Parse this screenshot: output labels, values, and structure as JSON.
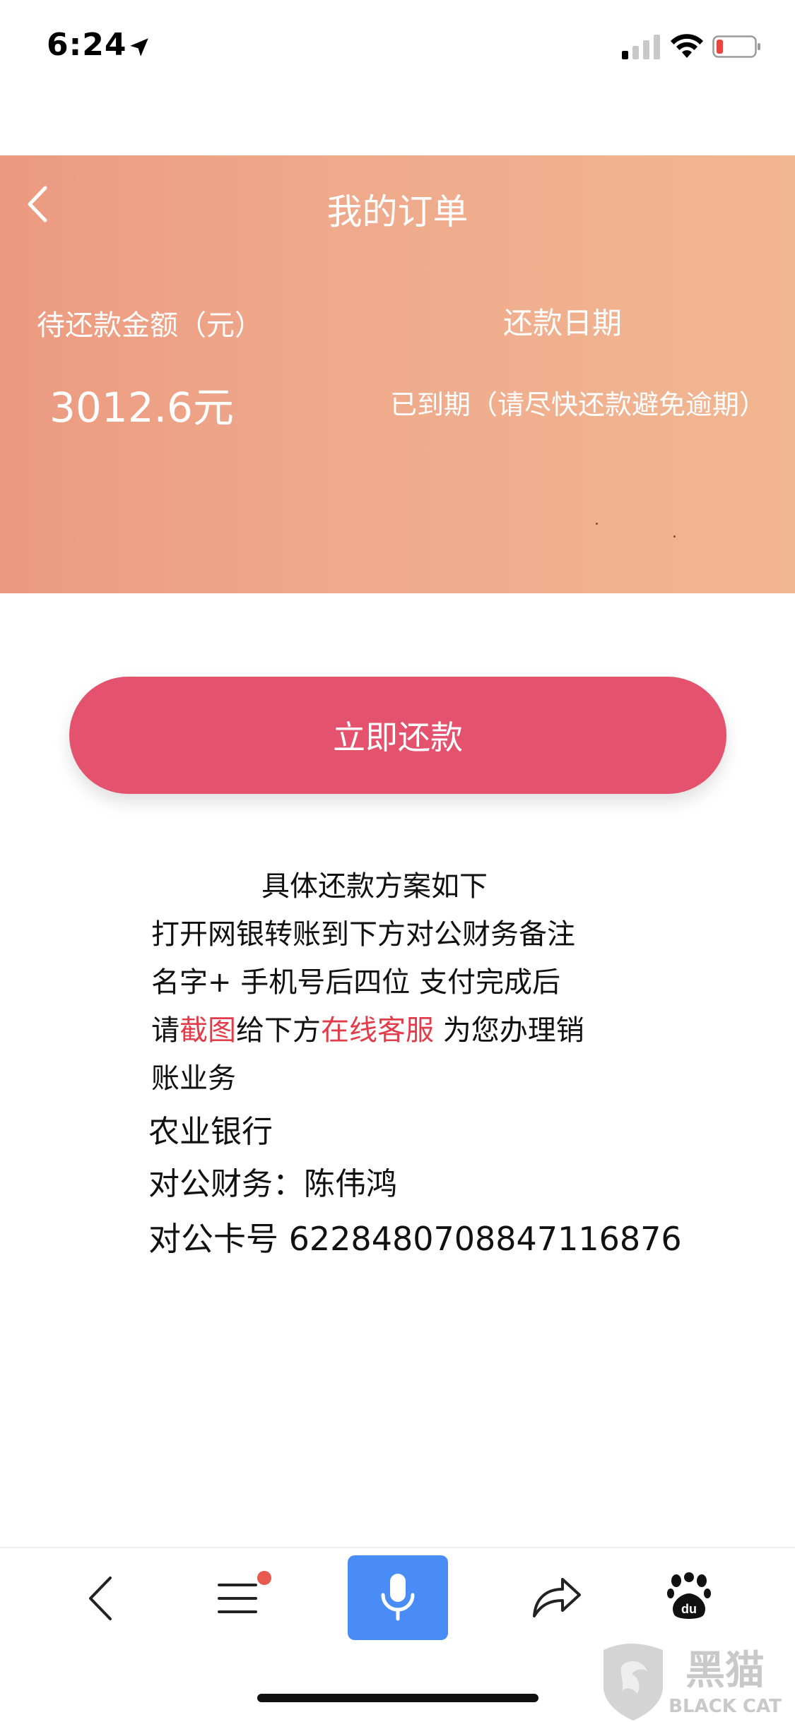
{
  "status_bar": {
    "time": "6:24",
    "icons": [
      "location-arrow-icon",
      "cellular-signal-icon",
      "wifi-icon",
      "battery-low-icon"
    ]
  },
  "header": {
    "title": "我的订单",
    "amount_label": "待还款金额（元）",
    "amount_value": "3012.6元",
    "date_label": "还款日期",
    "date_value": "已到期（请尽快还款避免逾期）",
    "gradient_colors": [
      "#ec9a80",
      "#f1b791"
    ]
  },
  "actions": {
    "repay_label": "立即还款",
    "repay_color": "#e4526e"
  },
  "instructions": {
    "line1": "具体还款方案如下",
    "line2": "打开网银转账到下方对公财务备注",
    "line3": "名字+ 手机号后四位 支付完成后",
    "line4_a": "请",
    "line4_b": "截图",
    "line4_c": "给下方",
    "line4_d": "在线客服",
    "line4_e": " 为您办理销",
    "line5": "账业务",
    "bank": "农业银行",
    "account_name": "对公财务：陈伟鸿",
    "card_number": "对公卡号 6228480708847116876",
    "highlight_color": "#e23b4a"
  },
  "toolbar": {
    "items": [
      "back-icon",
      "menu-icon",
      "microphone-icon",
      "share-icon",
      "baidu-paw-icon"
    ],
    "mic_color": "#4a8cf6"
  },
  "watermark": {
    "text_cn": "黑猫",
    "text_en": "BLACK CAT"
  }
}
